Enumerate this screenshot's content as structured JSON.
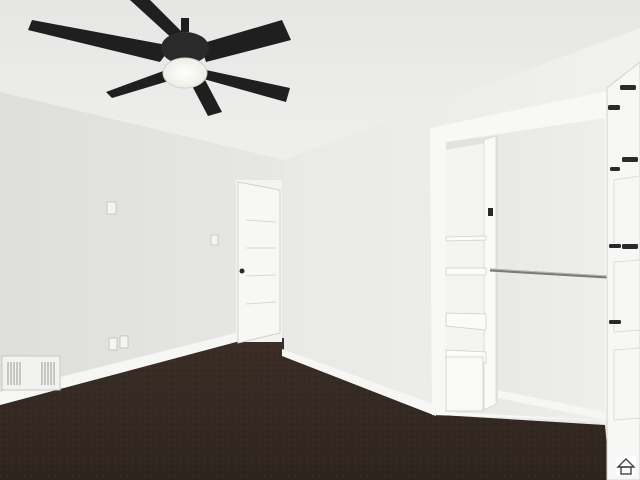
{
  "scene": {
    "description_colors": {
      "ceiling": "#e8e8e6",
      "left_wall": "#e3e3e1",
      "right_wall": "#ebebe9",
      "carpet": "#3b2f27",
      "trim": "#f7f7f5",
      "fan_dark": "#1f1f1f",
      "fan_light": "#f4f4ee",
      "hardware": "#2a2a2a"
    },
    "icons": {
      "ceiling_fan": "ceiling-fan-icon",
      "watermark": "house-icon"
    }
  }
}
